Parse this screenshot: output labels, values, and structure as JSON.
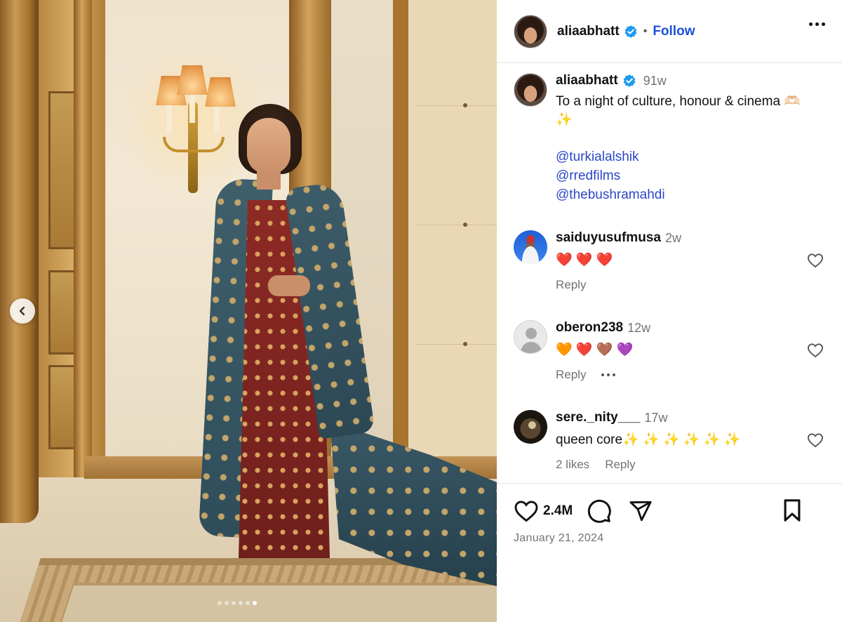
{
  "post": {
    "username": "aliaabhatt",
    "follow_label": "Follow",
    "separator": "•",
    "carousel": {
      "total": 6,
      "active_index": 5
    },
    "caption": {
      "username": "aliaabhatt",
      "time": "91w",
      "text": "To a night of culture, honour & cinema 🫶🏻\n✨",
      "mentions": [
        "@turkialalshik",
        "@rredfilms",
        "@thebushramahdi"
      ]
    },
    "comments": [
      {
        "username": "saiduyusufmusa",
        "time": "2w",
        "text": "❤️ ❤️ ❤️",
        "reply_label": "Reply",
        "likes_label": ""
      },
      {
        "username": "oberon238",
        "time": "12w",
        "text": "🧡 ❤️ 🤎 💜",
        "reply_label": "Reply",
        "likes_label": ""
      },
      {
        "username": "sere._nity___",
        "time": "17w",
        "text": "queen core✨ ✨ ✨ ✨ ✨ ✨",
        "reply_label": "Reply",
        "likes_label": "2 likes"
      }
    ],
    "like_count": "2.4M",
    "date": "January 21, 2024"
  },
  "icons": {
    "verified": "verified-badge-icon",
    "more": "more-options-icon",
    "like": "heart-icon",
    "comment": "comment-icon",
    "share": "share-icon",
    "save": "bookmark-icon",
    "prev": "chevron-left-icon"
  },
  "colors": {
    "link": "#2b46c8",
    "follow": "#1f4fd8",
    "verified": "#1d9bf0",
    "muted": "#737373"
  }
}
